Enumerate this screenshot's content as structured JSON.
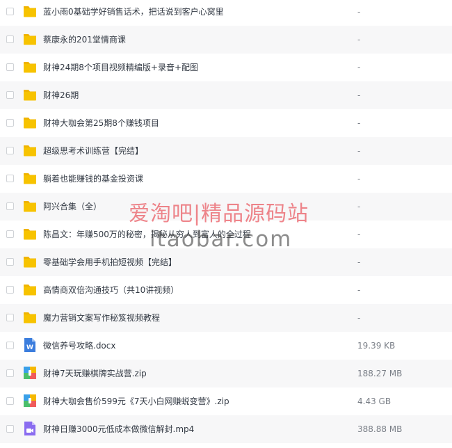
{
  "files": [
    {
      "name": "蓝小雨0基础学好销售话术，把话说到客户心窝里",
      "size": "-",
      "type": "folder"
    },
    {
      "name": "蔡康永的201堂情商课",
      "size": "-",
      "type": "folder"
    },
    {
      "name": "财神24期8个项目视频精编版+录音+配图",
      "size": "-",
      "type": "folder"
    },
    {
      "name": "财神26期",
      "size": "-",
      "type": "folder"
    },
    {
      "name": "财神大咖会第25期8个赚钱项目",
      "size": "-",
      "type": "folder"
    },
    {
      "name": "超级思考术训练营【完结】",
      "size": "-",
      "type": "folder"
    },
    {
      "name": "躺着也能赚钱的基金投资课",
      "size": "-",
      "type": "folder"
    },
    {
      "name": "阿兴合集（全）",
      "size": "-",
      "type": "folder"
    },
    {
      "name": "陈昌文：年赚500万的秘密，揭秘从穷人到富人的全过程",
      "size": "-",
      "type": "folder"
    },
    {
      "name": "零基础学会用手机拍短视频【完结】",
      "size": "-",
      "type": "folder"
    },
    {
      "name": "高情商双倍沟通技巧（共10讲视频）",
      "size": "-",
      "type": "folder"
    },
    {
      "name": "魔力营销文案写作秘笈视频教程",
      "size": "-",
      "type": "folder"
    },
    {
      "name": "微信养号攻略.docx",
      "size": "19.39 KB",
      "type": "doc"
    },
    {
      "name": "财神7天玩赚棋牌实战营.zip",
      "size": "188.27 MB",
      "type": "zip"
    },
    {
      "name": "财神大咖会售价599元《7天小白网赚蜕变营》.zip",
      "size": "4.43 GB",
      "type": "zip"
    },
    {
      "name": "财神日赚3000元低成本做微信解封.mp4",
      "size": "388.88 MB",
      "type": "video"
    }
  ],
  "watermark": {
    "line1": "爱淘吧|精品源码站",
    "line2": "itaobar.com"
  },
  "colors": {
    "folder": "#f7c300",
    "doc": "#3b7ddd",
    "video": "#8a6cf0",
    "text": "#333a44"
  }
}
